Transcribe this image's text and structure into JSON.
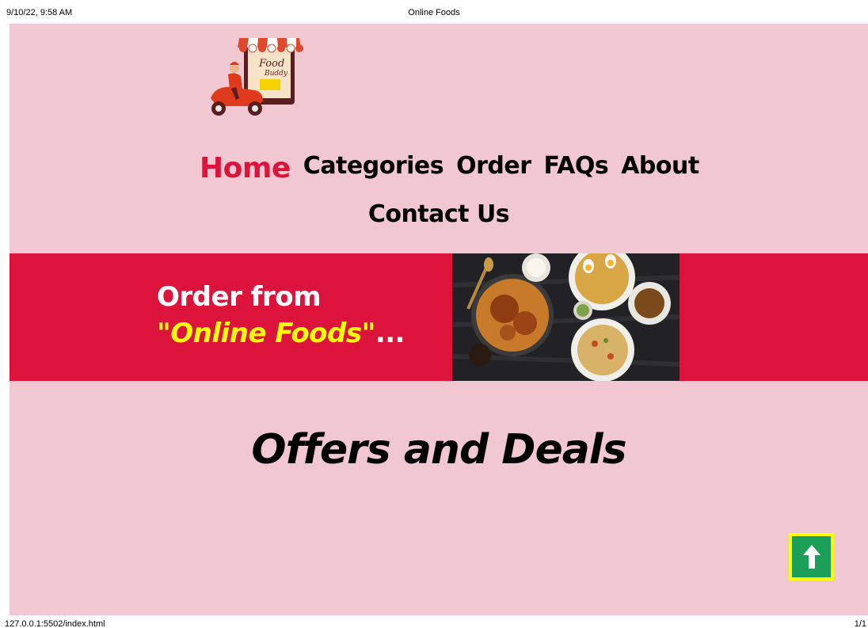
{
  "print_header": {
    "date": "9/10/22, 9:58 AM",
    "title": "Online Foods"
  },
  "logo": {
    "text_line1": "Food",
    "text_line2": "Buddy"
  },
  "nav": {
    "items": [
      {
        "label": "Home",
        "active": true
      },
      {
        "label": "Categories",
        "active": false
      },
      {
        "label": "Order",
        "active": false
      },
      {
        "label": "FAQs",
        "active": false
      },
      {
        "label": "About",
        "active": false
      },
      {
        "label": "Contact Us",
        "active": false
      }
    ]
  },
  "hero": {
    "line1": "Order from",
    "brand": "\"Online Foods\"",
    "ellipsis": "..."
  },
  "offers": {
    "title": "Offers and Deals"
  },
  "back_to_top": {
    "icon": "arrow-up-icon"
  },
  "print_footer": {
    "url": "127.0.0.1:5502/index.html",
    "page": "1/1"
  },
  "colors": {
    "page_bg": "#f1c8d1",
    "accent": "#dc143c",
    "brand_yellow": "#ffff00",
    "button_green": "#1b9e55"
  }
}
